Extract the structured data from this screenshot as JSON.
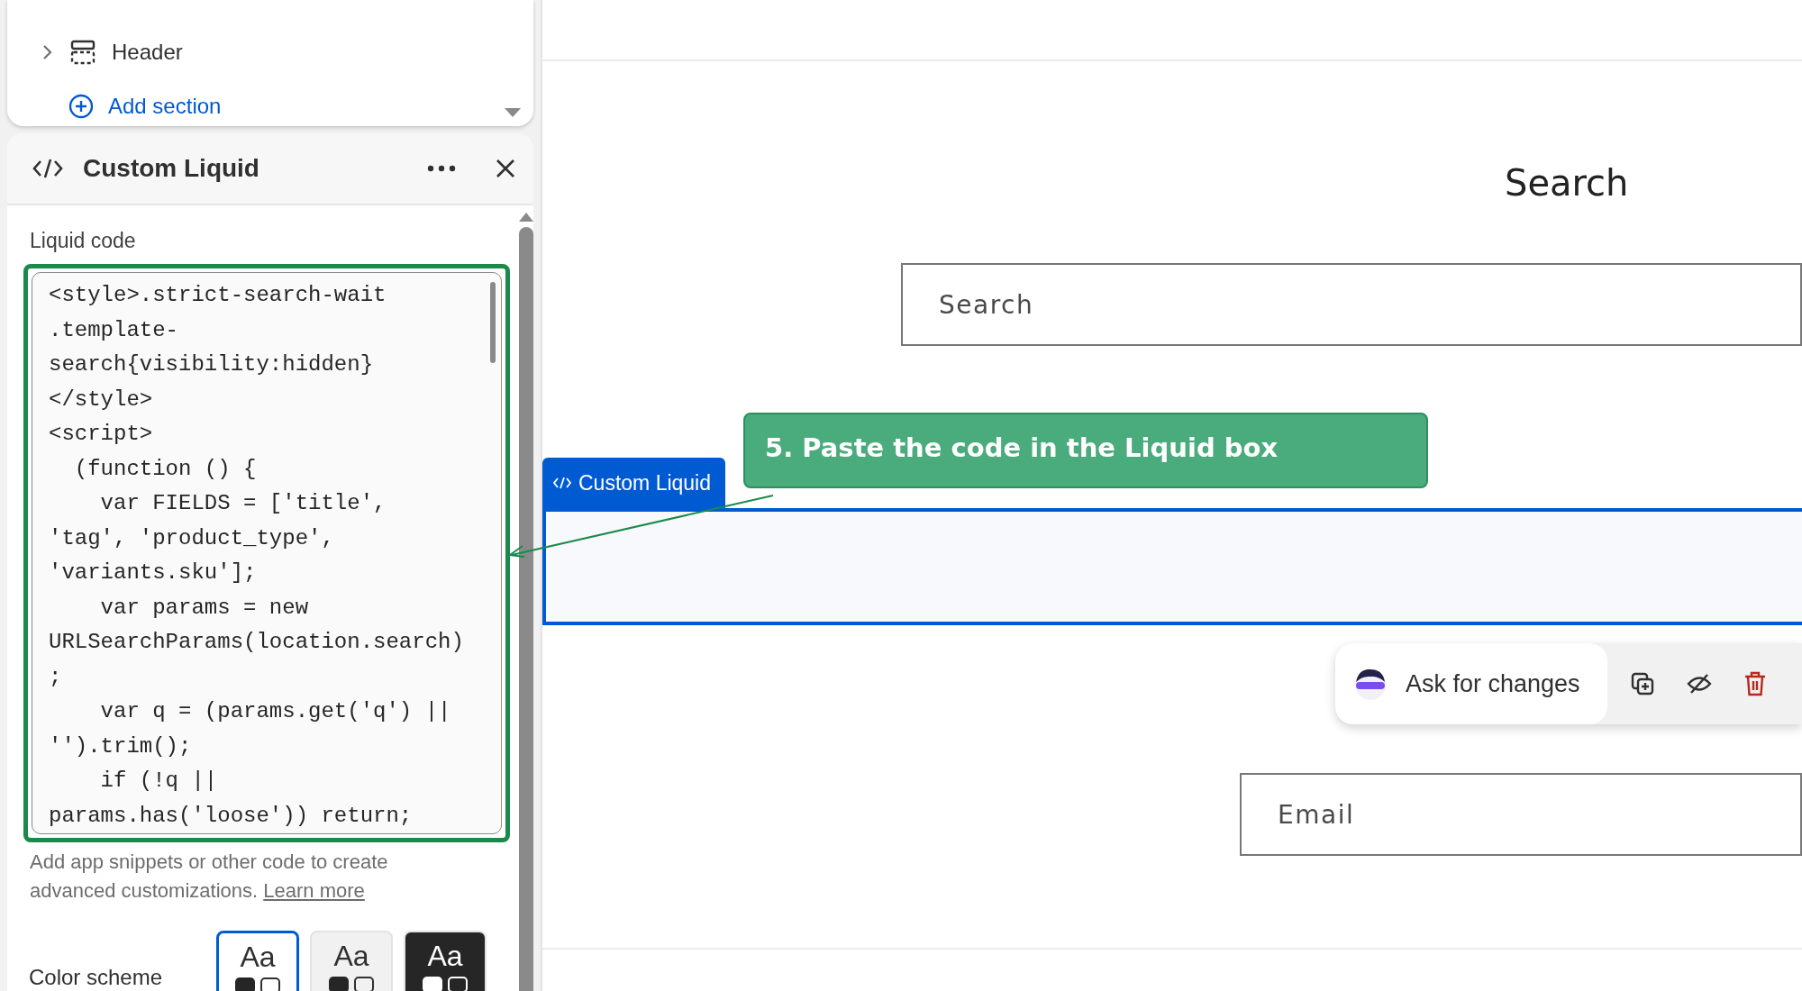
{
  "sections": [
    {
      "label": "Header",
      "expandable": true
    }
  ],
  "add_section": "Add section",
  "block_panel": {
    "title": "Custom Liquid",
    "field_label": "Liquid code",
    "code_lines": [
      "<style>.strict-search-wait",
      ".template-",
      "search{visibility:hidden}",
      "</style>",
      "<script>",
      "  (function () {",
      "    var FIELDS = ['title',",
      "'tag', 'product_type',",
      "'variants.sku'];",
      "    var params = new",
      "URLSearchParams(location.search)",
      ";",
      "    var q = (params.get('q') ||",
      "'').trim();",
      "    if (!q ||",
      "params.has('loose')) return;"
    ],
    "help_text": "Add app snippets or other code to create advanced customizations.",
    "help_link": "Learn more",
    "color_scheme_label": "Color scheme",
    "color_schemes": [
      {
        "label": "Aa",
        "selected": true,
        "color": "#ffffff"
      },
      {
        "label": "Aa",
        "selected": false,
        "color": "#f1f1f1"
      },
      {
        "label": "Aa",
        "selected": false,
        "color": "#262626"
      }
    ]
  },
  "preview": {
    "heading": "Search",
    "search_placeholder": "Search",
    "block_tag": "Custom Liquid",
    "callout": "5. Paste the code in the Liquid box",
    "email_placeholder": "Email",
    "toolbar": {
      "ask_label": "Ask for changes"
    }
  }
}
